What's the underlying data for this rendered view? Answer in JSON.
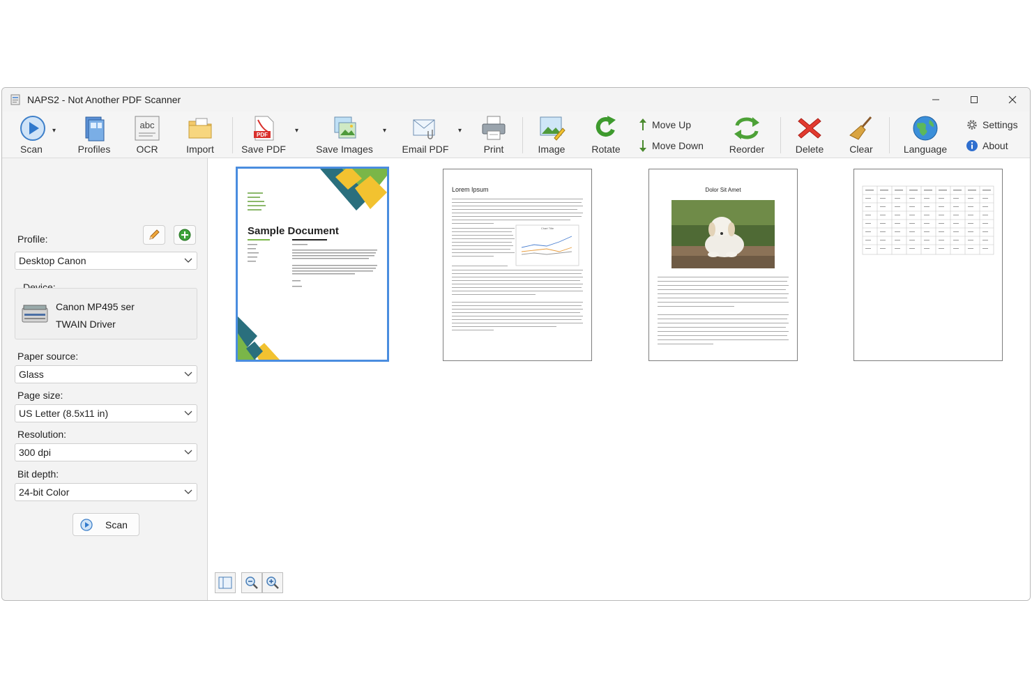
{
  "window": {
    "title": "NAPS2 - Not Another PDF Scanner"
  },
  "toolbar": {
    "scan": "Scan",
    "profiles": "Profiles",
    "ocr": "OCR",
    "ocr_icon_text": "abc",
    "import": "Import",
    "save_pdf": "Save PDF",
    "save_pdf_icon_text": "PDF",
    "save_images": "Save Images",
    "email_pdf": "Email PDF",
    "print": "Print",
    "image": "Image",
    "rotate": "Rotate",
    "move_up": "Move Up",
    "move_down": "Move Down",
    "reorder": "Reorder",
    "delete": "Delete",
    "clear": "Clear",
    "language": "Language",
    "settings": "Settings",
    "about": "About"
  },
  "sidebar": {
    "profile_label": "Profile:",
    "profile_value": "Desktop Canon",
    "device_label": "Device:",
    "device_name": "Canon MP495 ser",
    "device_driver": "TWAIN Driver",
    "paper_source_label": "Paper source:",
    "paper_source_value": "Glass",
    "page_size_label": "Page size:",
    "page_size_value": "US Letter (8.5x11 in)",
    "resolution_label": "Resolution:",
    "resolution_value": "300 dpi",
    "bit_depth_label": "Bit depth:",
    "bit_depth_value": "24-bit Color",
    "scan_button": "Scan"
  },
  "pages": [
    {
      "title": "Sample Document",
      "selected": true
    },
    {
      "title": "Lorem Ipsum",
      "chart_caption": "Chart Title",
      "selected": false
    },
    {
      "title": "Dolor Sit Amet",
      "selected": false
    },
    {
      "title": "",
      "selected": false
    }
  ],
  "colors": {
    "accent": "#4a8ddf",
    "window_bg": "#f3f3f3",
    "doc_yellow": "#f2c230",
    "doc_teal": "#2a6f7d",
    "doc_green": "#7ab648"
  }
}
